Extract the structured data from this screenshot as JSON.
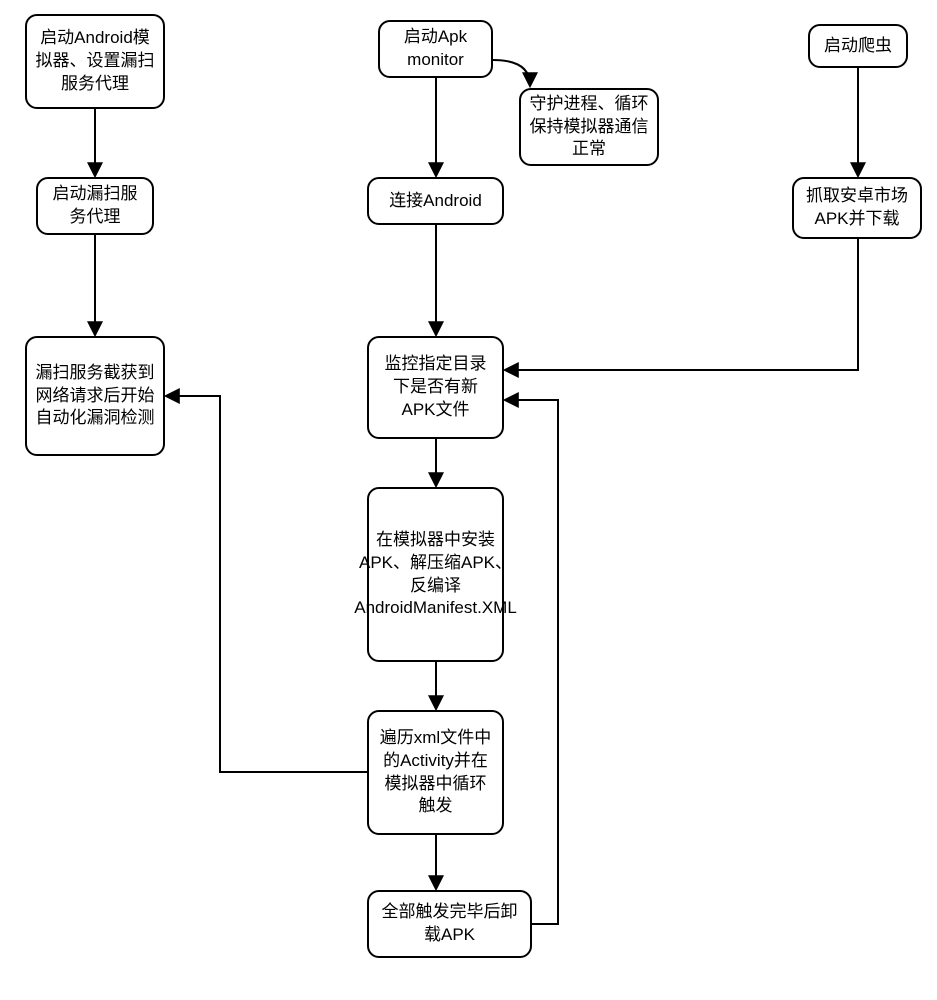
{
  "nodes": {
    "n1": "启动Android模拟器、设置漏扫服务代理",
    "n2": "启动漏扫服务代理",
    "n3": "漏扫服务截获到网络请求后开始自动化漏洞检测",
    "n4": "启动Apk monitor",
    "n5": "守护进程、循环保持模拟器通信正常",
    "n6": "连接Android",
    "n7": "监控指定目录下是否有新APK文件",
    "n8": "在模拟器中安装APK、解压缩APK、反编译AndroidManifest.XML",
    "n9": "遍历xml文件中的Activity并在模拟器中循环触发",
    "n10": "全部触发完毕后卸载APK",
    "n11": "启动爬虫",
    "n12": "抓取安卓市场APK并下载"
  }
}
